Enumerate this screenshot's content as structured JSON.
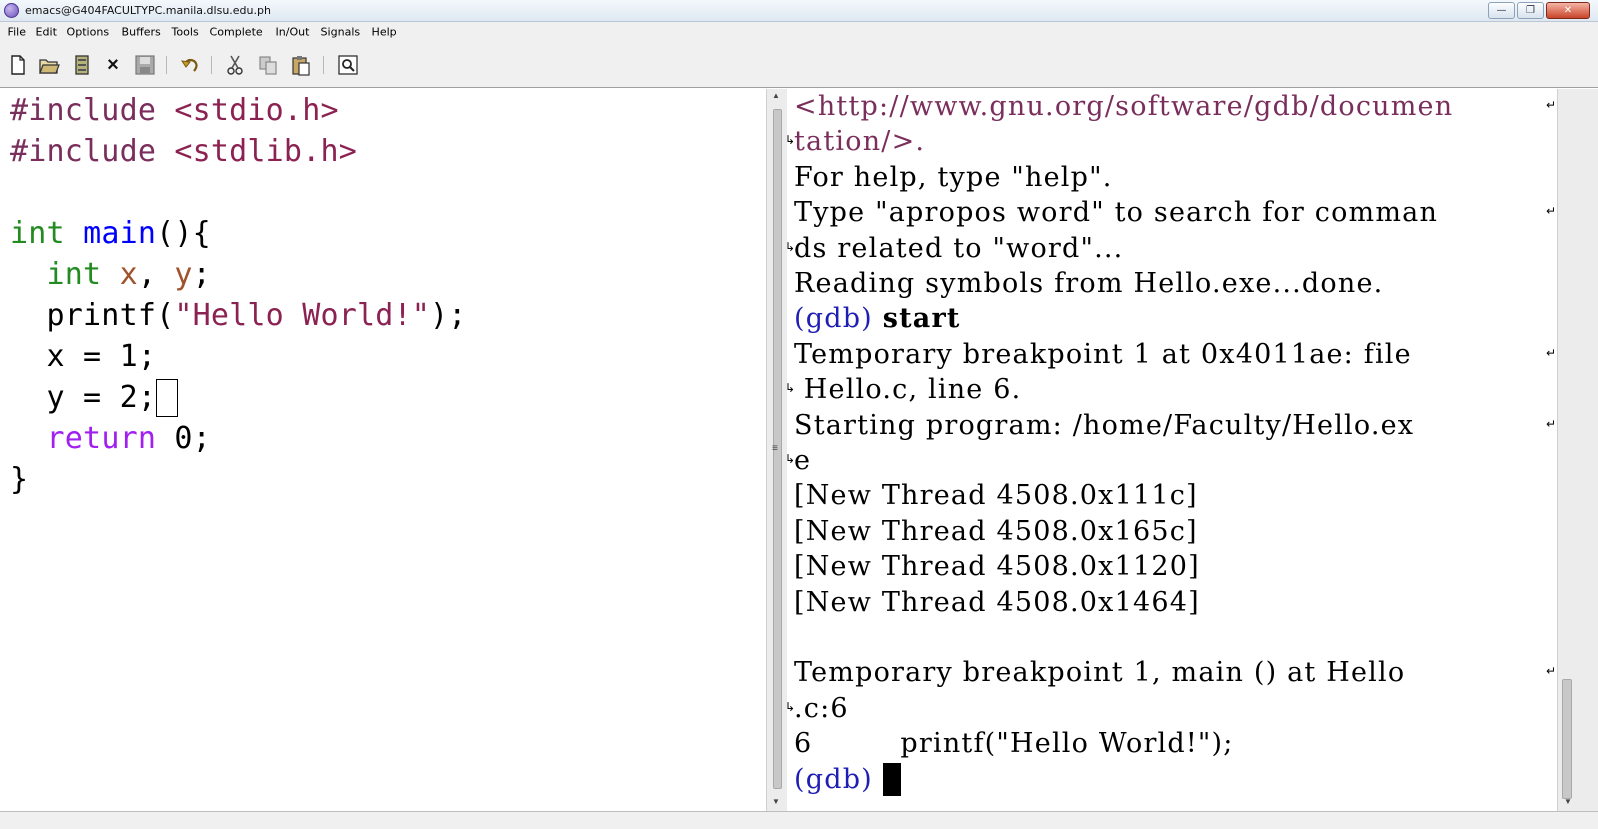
{
  "window": {
    "title": "emacs@G404FACULTYPC.manila.dlsu.edu.ph",
    "minimize_label": "—",
    "maximize_label": "❐",
    "close_label": "✕"
  },
  "menubar": {
    "items": [
      "File",
      "Edit",
      "Options",
      "Buffers",
      "Tools",
      "Complete",
      "In/Out",
      "Signals",
      "Help"
    ]
  },
  "toolbar": {
    "icons": [
      "new-file-icon",
      "open-folder-icon",
      "save-dir-icon",
      "close-buffer-icon",
      "save-icon",
      "undo-icon",
      "cut-icon",
      "copy-icon",
      "paste-icon",
      "search-icon"
    ],
    "close_glyph": "×"
  },
  "source_pane": {
    "lines": [
      [
        {
          "t": "#include ",
          "c": "pre"
        },
        {
          "t": "<stdio.h>",
          "c": "str"
        }
      ],
      [
        {
          "t": "#include ",
          "c": "pre"
        },
        {
          "t": "<stdlib.h>",
          "c": "str"
        }
      ],
      [],
      [
        {
          "t": "int",
          "c": "type"
        },
        {
          "t": " ",
          "c": "plain"
        },
        {
          "t": "main",
          "c": "fn"
        },
        {
          "t": "(){",
          "c": "plain"
        }
      ],
      [
        {
          "t": "  ",
          "c": "plain"
        },
        {
          "t": "int",
          "c": "type"
        },
        {
          "t": " ",
          "c": "plain"
        },
        {
          "t": "x",
          "c": "var"
        },
        {
          "t": ", ",
          "c": "plain"
        },
        {
          "t": "y",
          "c": "var"
        },
        {
          "t": ";",
          "c": "plain"
        }
      ],
      [
        {
          "t": "  printf(",
          "c": "plain"
        },
        {
          "t": "\"Hello World!\"",
          "c": "str"
        },
        {
          "t": ");",
          "c": "plain"
        }
      ],
      [
        {
          "t": "  x = 1;",
          "c": "plain"
        }
      ],
      [
        {
          "t": "  y = 2;",
          "c": "plain"
        },
        {
          "cursor": "box"
        }
      ],
      [
        {
          "t": "  ",
          "c": "plain"
        },
        {
          "t": "return",
          "c": "kw"
        },
        {
          "t": " 0;",
          "c": "plain"
        }
      ],
      [
        {
          "t": "}",
          "c": "plain"
        }
      ]
    ]
  },
  "gdb_pane": {
    "lines": [
      [
        {
          "t": "<http://www.gnu.org/software/gdb/documen",
          "c": "link"
        }
      ],
      [
        {
          "t": "tation/>.",
          "c": "link"
        }
      ],
      [
        {
          "t": "For help, type \"help\".",
          "c": "plain"
        }
      ],
      [
        {
          "t": "Type \"apropos word\" to search for comman",
          "c": "plain"
        }
      ],
      [
        {
          "t": "ds related to \"word\"...",
          "c": "plain"
        }
      ],
      [
        {
          "t": "Reading symbols from Hello.exe...done.",
          "c": "plain"
        }
      ],
      [
        {
          "t": "(gdb) ",
          "c": "prompt"
        },
        {
          "t": "start",
          "c": "cmd"
        }
      ],
      [
        {
          "t": "Temporary breakpoint 1 at 0x4011ae: file",
          "c": "plain"
        }
      ],
      [
        {
          "t": " Hello.c, line 6.",
          "c": "plain"
        }
      ],
      [
        {
          "t": "Starting program: /home/Faculty/Hello.ex",
          "c": "plain"
        }
      ],
      [
        {
          "t": "e",
          "c": "plain"
        }
      ],
      [
        {
          "t": "[New Thread 4508.0x111c]",
          "c": "plain"
        }
      ],
      [
        {
          "t": "[New Thread 4508.0x165c]",
          "c": "plain"
        }
      ],
      [
        {
          "t": "[New Thread 4508.0x1120]",
          "c": "plain"
        }
      ],
      [
        {
          "t": "[New Thread 4508.0x1464]",
          "c": "plain"
        }
      ],
      [],
      [
        {
          "t": "Temporary breakpoint 1, main () at Hello",
          "c": "plain"
        }
      ],
      [
        {
          "t": ".c:6",
          "c": "plain"
        }
      ],
      [
        {
          "t": "6         printf(\"Hello World!\");",
          "c": "plain"
        }
      ],
      [
        {
          "t": "(gdb) ",
          "c": "prompt"
        },
        {
          "cursor": "block"
        }
      ]
    ],
    "continuation_glyph": "↵",
    "continuation_start_glyph": "↳"
  },
  "colors": {
    "preprocessor": "#7a2e5c",
    "string": "#8b2252",
    "type": "#228b22",
    "function": "#0000ff",
    "variable": "#a0522d",
    "keyword": "#a020f0",
    "gdb_prompt": "#1e1eb4"
  }
}
